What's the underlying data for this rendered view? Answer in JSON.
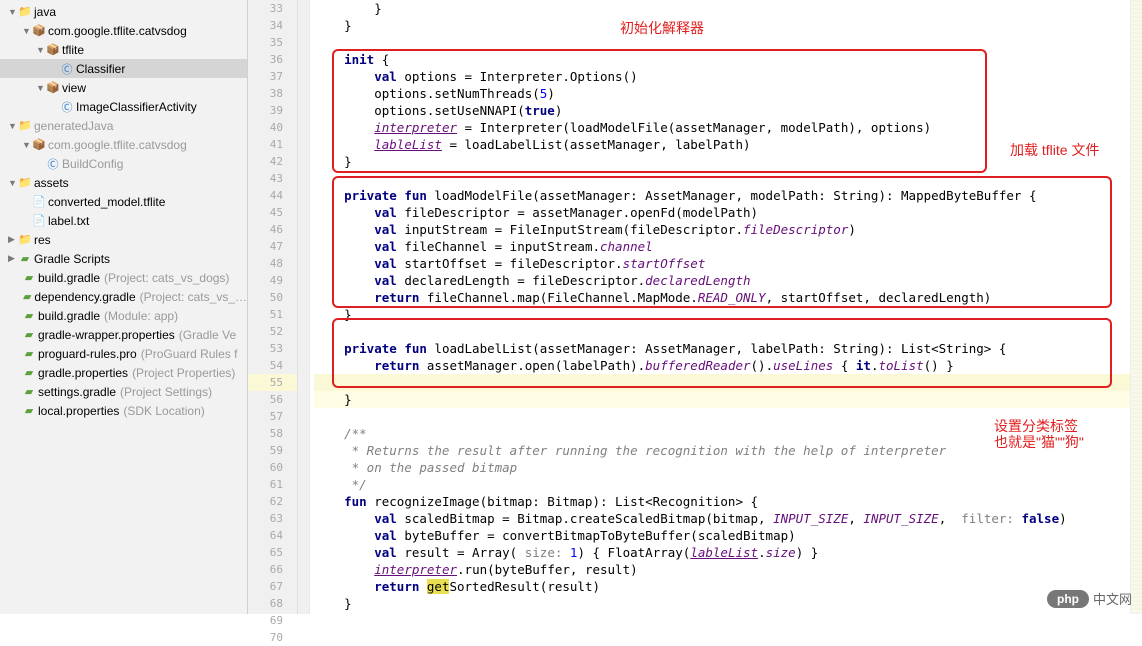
{
  "tree": {
    "java": {
      "label": "java"
    },
    "pkg1": {
      "label": "com.google.tflite.catvsdog"
    },
    "tflite": {
      "label": "tflite"
    },
    "classifier": {
      "label": "Classifier"
    },
    "view": {
      "label": "view"
    },
    "activity": {
      "label": "ImageClassifierActivity"
    },
    "genJava": {
      "label": "generatedJava"
    },
    "pkg2": {
      "label": "com.google.tflite.catvsdog"
    },
    "buildConfig": {
      "label": "BuildConfig"
    },
    "assets": {
      "label": "assets"
    },
    "model": {
      "label": "converted_model.tflite"
    },
    "labeltxt": {
      "label": "label.txt"
    },
    "res": {
      "label": "res"
    },
    "scripts": {
      "label": "Gradle Scripts"
    },
    "bg1": {
      "label": "build.gradle",
      "hint": "(Project: cats_vs_dogs)"
    },
    "dep": {
      "label": "dependency.gradle",
      "hint": "(Project: cats_vs_…"
    },
    "bg2": {
      "label": "build.gradle",
      "hint": "(Module: app)"
    },
    "gwp": {
      "label": "gradle-wrapper.properties",
      "hint": "(Gradle Ve"
    },
    "pg": {
      "label": "proguard-rules.pro",
      "hint": "(ProGuard Rules f"
    },
    "gp": {
      "label": "gradle.properties",
      "hint": "(Project Properties)"
    },
    "sg": {
      "label": "settings.gradle",
      "hint": "(Project Settings)"
    },
    "lp": {
      "label": "local.properties",
      "hint": "(SDK Location)"
    }
  },
  "lines": {
    "start": 33,
    "end": 70
  },
  "annotations": {
    "a1": "初始化解释器",
    "a2": "加载 tflite 文件",
    "a3a": "设置分类标签",
    "a3b": "也就是\"猫\"\"狗\""
  },
  "code": {
    "l33": "        }",
    "l34": "    }",
    "l35": "",
    "l36": {
      "pre": "    ",
      "kw": "init",
      "rest": " {"
    },
    "l37": {
      "pre": "        ",
      "kw": "val",
      "n": " options = Interpreter.Options()"
    },
    "l38": "        options.setNumThreads(5)",
    "l39": {
      "pre": "        options.setUseNNAPI(",
      "kw": "true",
      "post": ")"
    },
    "l40": {
      "pre": "        ",
      "u": "interpreter",
      "rest": " = Interpreter(loadModelFile(assetManager, modelPath), options)"
    },
    "l41": {
      "pre": "        ",
      "u": "lableList",
      "rest": " = loadLabelList(assetManager, labelPath)"
    },
    "l42": "    }",
    "l43": "",
    "l44": {
      "pre": "    ",
      "k1": "private fun",
      "mid": " loadModelFile(assetManager: AssetManager, modelPath: String): MappedByteBuffer {"
    },
    "l45": {
      "pre": "        ",
      "kw": "val",
      "rest": " fileDescriptor = assetManager.openFd(modelPath)"
    },
    "l46": {
      "pre": "        ",
      "kw": "val",
      "mid": " inputStream = FileInputStream(fileDescriptor.",
      "pp": "fileDescriptor",
      "post": ")"
    },
    "l47": {
      "pre": "        ",
      "kw": "val",
      "mid": " fileChannel = inputStream.",
      "pp": "channel"
    },
    "l48": {
      "pre": "        ",
      "kw": "val",
      "mid": " startOffset = fileDescriptor.",
      "pp": "startOffset"
    },
    "l49": {
      "pre": "        ",
      "kw": "val",
      "mid": " declaredLength = fileDescriptor.",
      "pp": "declaredLength"
    },
    "l50": {
      "pre": "        ",
      "kw": "return",
      "mid": " fileChannel.map(FileChannel.MapMode.",
      "pp": "READ_ONLY",
      "post": ", startOffset, declaredLength)"
    },
    "l51": "    }",
    "l52": "",
    "l53": {
      "pre": "    ",
      "k1": "private fun",
      "mid": " loadLabelList(assetManager: AssetManager, labelPath: String): List<String> {"
    },
    "l54": {
      "pre": "        ",
      "kw": "return",
      "mid": " assetManager.open(labelPath).",
      "p1": "bufferedReader",
      "mid2": "().",
      "p2": "useLines",
      "mid3": " { ",
      "p3": "it",
      "mid4": ".",
      "p4": "toList",
      "post": "() }"
    },
    "l55": "",
    "l56": "    }",
    "l57": "",
    "l58": "    /**",
    "l59": "     * Returns the result after running the recognition with the help of interpreter",
    "l60": "     * on the passed bitmap",
    "l61": "     */",
    "l62": {
      "pre": "    ",
      "kw": "fun",
      "rest": " recognizeImage(bitmap: Bitmap): List<Recognition> {"
    },
    "l63": {
      "pre": "        ",
      "kw": "val",
      "mid": " scaledBitmap = Bitmap.createScaledBitmap(bitmap, ",
      "c1": "INPUT_SIZE",
      "mid2": ", ",
      "c2": "INPUT_SIZE",
      "mid3": ",  ",
      "hint": "filter: ",
      "kw2": "false",
      "post": ")"
    },
    "l64": {
      "pre": "        ",
      "kw": "val",
      "rest": " byteBuffer = convertBitmapToByteBuffer(scaledBitmap)"
    },
    "l65": {
      "pre": "        ",
      "kw": "val",
      "mid": " result = Array(",
      "hint": " size: ",
      "num": "1",
      "mid2": ") { FloatArray(",
      "u": "lableList",
      "mid3": ".",
      "pp": "size",
      "post": ") }"
    },
    "l66": {
      "pre": "        ",
      "u": "interpreter",
      "rest": ".run(byteBuffer, result)"
    },
    "l67": {
      "pre": "        ",
      "kw": "return ",
      "hl": "get",
      "rest": "SortedResult(result)"
    },
    "l68": "    }",
    "l69": ""
  },
  "watermark": {
    "php": "php",
    "cn": "中文网"
  }
}
